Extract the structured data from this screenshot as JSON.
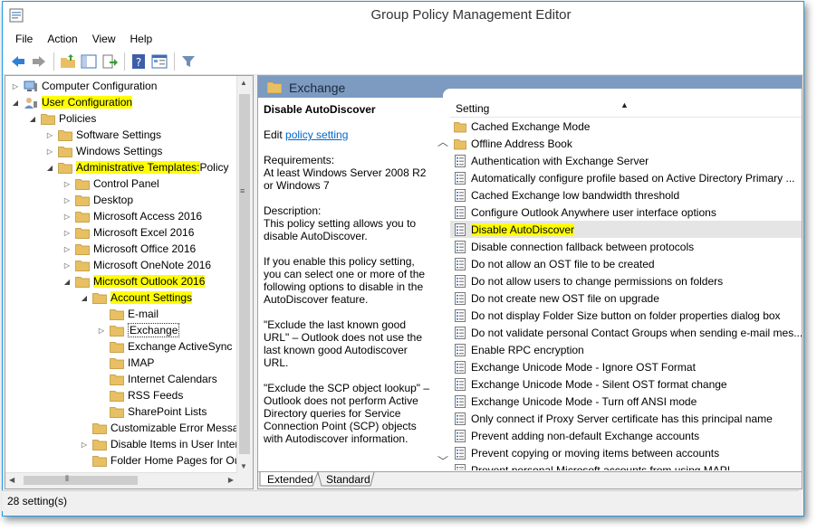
{
  "window": {
    "title": "Group Policy Management Editor"
  },
  "menu": [
    "File",
    "Action",
    "View",
    "Help"
  ],
  "toolbar": {
    "icons": [
      "back-arrow-icon",
      "forward-arrow-icon",
      "up-folder-icon",
      "show-hide-tree-icon",
      "export-list-icon",
      "help-icon",
      "properties-icon",
      "filter-icon"
    ]
  },
  "tree": {
    "items": [
      {
        "label": "Computer Configuration",
        "level": 0,
        "expander": "collapsed",
        "icon": "computer",
        "highlight": false
      },
      {
        "label": "User Configuration",
        "level": 0,
        "expander": "expanded",
        "icon": "user",
        "highlight": true
      },
      {
        "label": "Policies",
        "level": 1,
        "expander": "expanded",
        "icon": "folder",
        "highlight": false
      },
      {
        "label": "Software Settings",
        "level": 2,
        "expander": "collapsed",
        "icon": "folder",
        "highlight": false
      },
      {
        "label": "Windows Settings",
        "level": 2,
        "expander": "collapsed",
        "icon": "folder",
        "highlight": false
      },
      {
        "label": "Administrative Templates:",
        "suffix": " Policy",
        "level": 2,
        "expander": "expanded",
        "icon": "folder",
        "highlight": true
      },
      {
        "label": "Control Panel",
        "level": 3,
        "expander": "collapsed",
        "icon": "folder",
        "highlight": false
      },
      {
        "label": "Desktop",
        "level": 3,
        "expander": "collapsed",
        "icon": "folder",
        "highlight": false
      },
      {
        "label": "Microsoft Access 2016",
        "level": 3,
        "expander": "collapsed",
        "icon": "folder",
        "highlight": false
      },
      {
        "label": "Microsoft Excel 2016",
        "level": 3,
        "expander": "collapsed",
        "icon": "folder",
        "highlight": false
      },
      {
        "label": "Microsoft Office 2016",
        "level": 3,
        "expander": "collapsed",
        "icon": "folder",
        "highlight": false
      },
      {
        "label": "Microsoft OneNote 2016",
        "level": 3,
        "expander": "collapsed",
        "icon": "folder",
        "highlight": false
      },
      {
        "label": "Microsoft Outlook 2016",
        "level": 3,
        "expander": "expanded",
        "icon": "folder",
        "highlight": true
      },
      {
        "label": "Account Settings",
        "level": 4,
        "expander": "expanded",
        "icon": "folder",
        "highlight": true
      },
      {
        "label": "E-mail",
        "level": 5,
        "expander": "none",
        "icon": "folder",
        "highlight": false
      },
      {
        "label": "Exchange",
        "level": 5,
        "expander": "collapsed",
        "icon": "folder",
        "highlight": true,
        "selected": true
      },
      {
        "label": "Exchange ActiveSync",
        "level": 5,
        "expander": "none",
        "icon": "folder",
        "highlight": false
      },
      {
        "label": "IMAP",
        "level": 5,
        "expander": "none",
        "icon": "folder",
        "highlight": false
      },
      {
        "label": "Internet Calendars",
        "level": 5,
        "expander": "none",
        "icon": "folder",
        "highlight": false
      },
      {
        "label": "RSS Feeds",
        "level": 5,
        "expander": "none",
        "icon": "folder",
        "highlight": false
      },
      {
        "label": "SharePoint Lists",
        "level": 5,
        "expander": "none",
        "icon": "folder",
        "highlight": false
      },
      {
        "label": "Customizable Error Messag",
        "level": 4,
        "expander": "none",
        "icon": "folder",
        "highlight": false
      },
      {
        "label": "Disable Items in User Interf",
        "level": 4,
        "expander": "collapsed",
        "icon": "folder",
        "highlight": false
      },
      {
        "label": "Folder Home Pages for Ou",
        "level": 4,
        "expander": "none",
        "icon": "folder",
        "highlight": false
      }
    ]
  },
  "details": {
    "header": "Exchange",
    "policy_title": "Disable AutoDiscover",
    "edit_prefix": "Edit ",
    "edit_link": "policy setting ",
    "requirements_label": "Requirements:",
    "requirements_text": "At least Windows Server 2008 R2 or Windows 7",
    "description_label": "Description:",
    "description_text": "This policy setting allows you to disable AutoDiscover.",
    "para1": "If you enable this policy setting, you can select one or more of the following options to disable in the AutoDiscover feature.",
    "para2": "\"Exclude the last known good URL\" – Outlook does not use the last known good Autodiscover URL.",
    "para3": "\"Exclude the SCP object lookup\" – Outlook does not perform Active Directory queries for Service Connection Point (SCP) objects with Autodiscover information."
  },
  "list": {
    "column": "Setting",
    "rows": [
      {
        "label": "Cached Exchange Mode",
        "icon": "folder"
      },
      {
        "label": "Offline Address Book",
        "icon": "folder"
      },
      {
        "label": "Authentication with Exchange Server",
        "icon": "setting"
      },
      {
        "label": "Automatically configure profile based on Active Directory Primary ...",
        "icon": "setting"
      },
      {
        "label": "Cached Exchange low bandwidth threshold",
        "icon": "setting"
      },
      {
        "label": "Configure Outlook Anywhere user interface options",
        "icon": "setting"
      },
      {
        "label": "Disable AutoDiscover",
        "icon": "setting",
        "highlight": true
      },
      {
        "label": "Disable connection fallback between protocols",
        "icon": "setting"
      },
      {
        "label": "Do not allow an OST file to be created",
        "icon": "setting"
      },
      {
        "label": "Do not allow users to change permissions on folders",
        "icon": "setting"
      },
      {
        "label": "Do not create new OST file on upgrade",
        "icon": "setting"
      },
      {
        "label": "Do not display Folder Size button on folder properties dialog box",
        "icon": "setting"
      },
      {
        "label": "Do not validate personal Contact Groups when sending e-mail mes...",
        "icon": "setting"
      },
      {
        "label": "Enable RPC encryption",
        "icon": "setting"
      },
      {
        "label": "Exchange Unicode Mode - Ignore OST Format",
        "icon": "setting"
      },
      {
        "label": "Exchange Unicode Mode - Silent OST format change",
        "icon": "setting"
      },
      {
        "label": "Exchange Unicode Mode - Turn off ANSI mode",
        "icon": "setting"
      },
      {
        "label": "Only connect if Proxy Server certificate has this principal name",
        "icon": "setting"
      },
      {
        "label": "Prevent adding non-default Exchange accounts",
        "icon": "setting"
      },
      {
        "label": "Prevent copying or moving items between accounts",
        "icon": "setting"
      },
      {
        "label": "Prevent personal Microsoft accounts from using MAPI",
        "icon": "setting"
      }
    ]
  },
  "tabs": [
    "Extended",
    "Standard"
  ],
  "status": "28 setting(s)",
  "colors": {
    "highlight": "#ffff00",
    "header": "#7d9bc1",
    "folder": "#e8c063",
    "link": "#0066cc"
  }
}
